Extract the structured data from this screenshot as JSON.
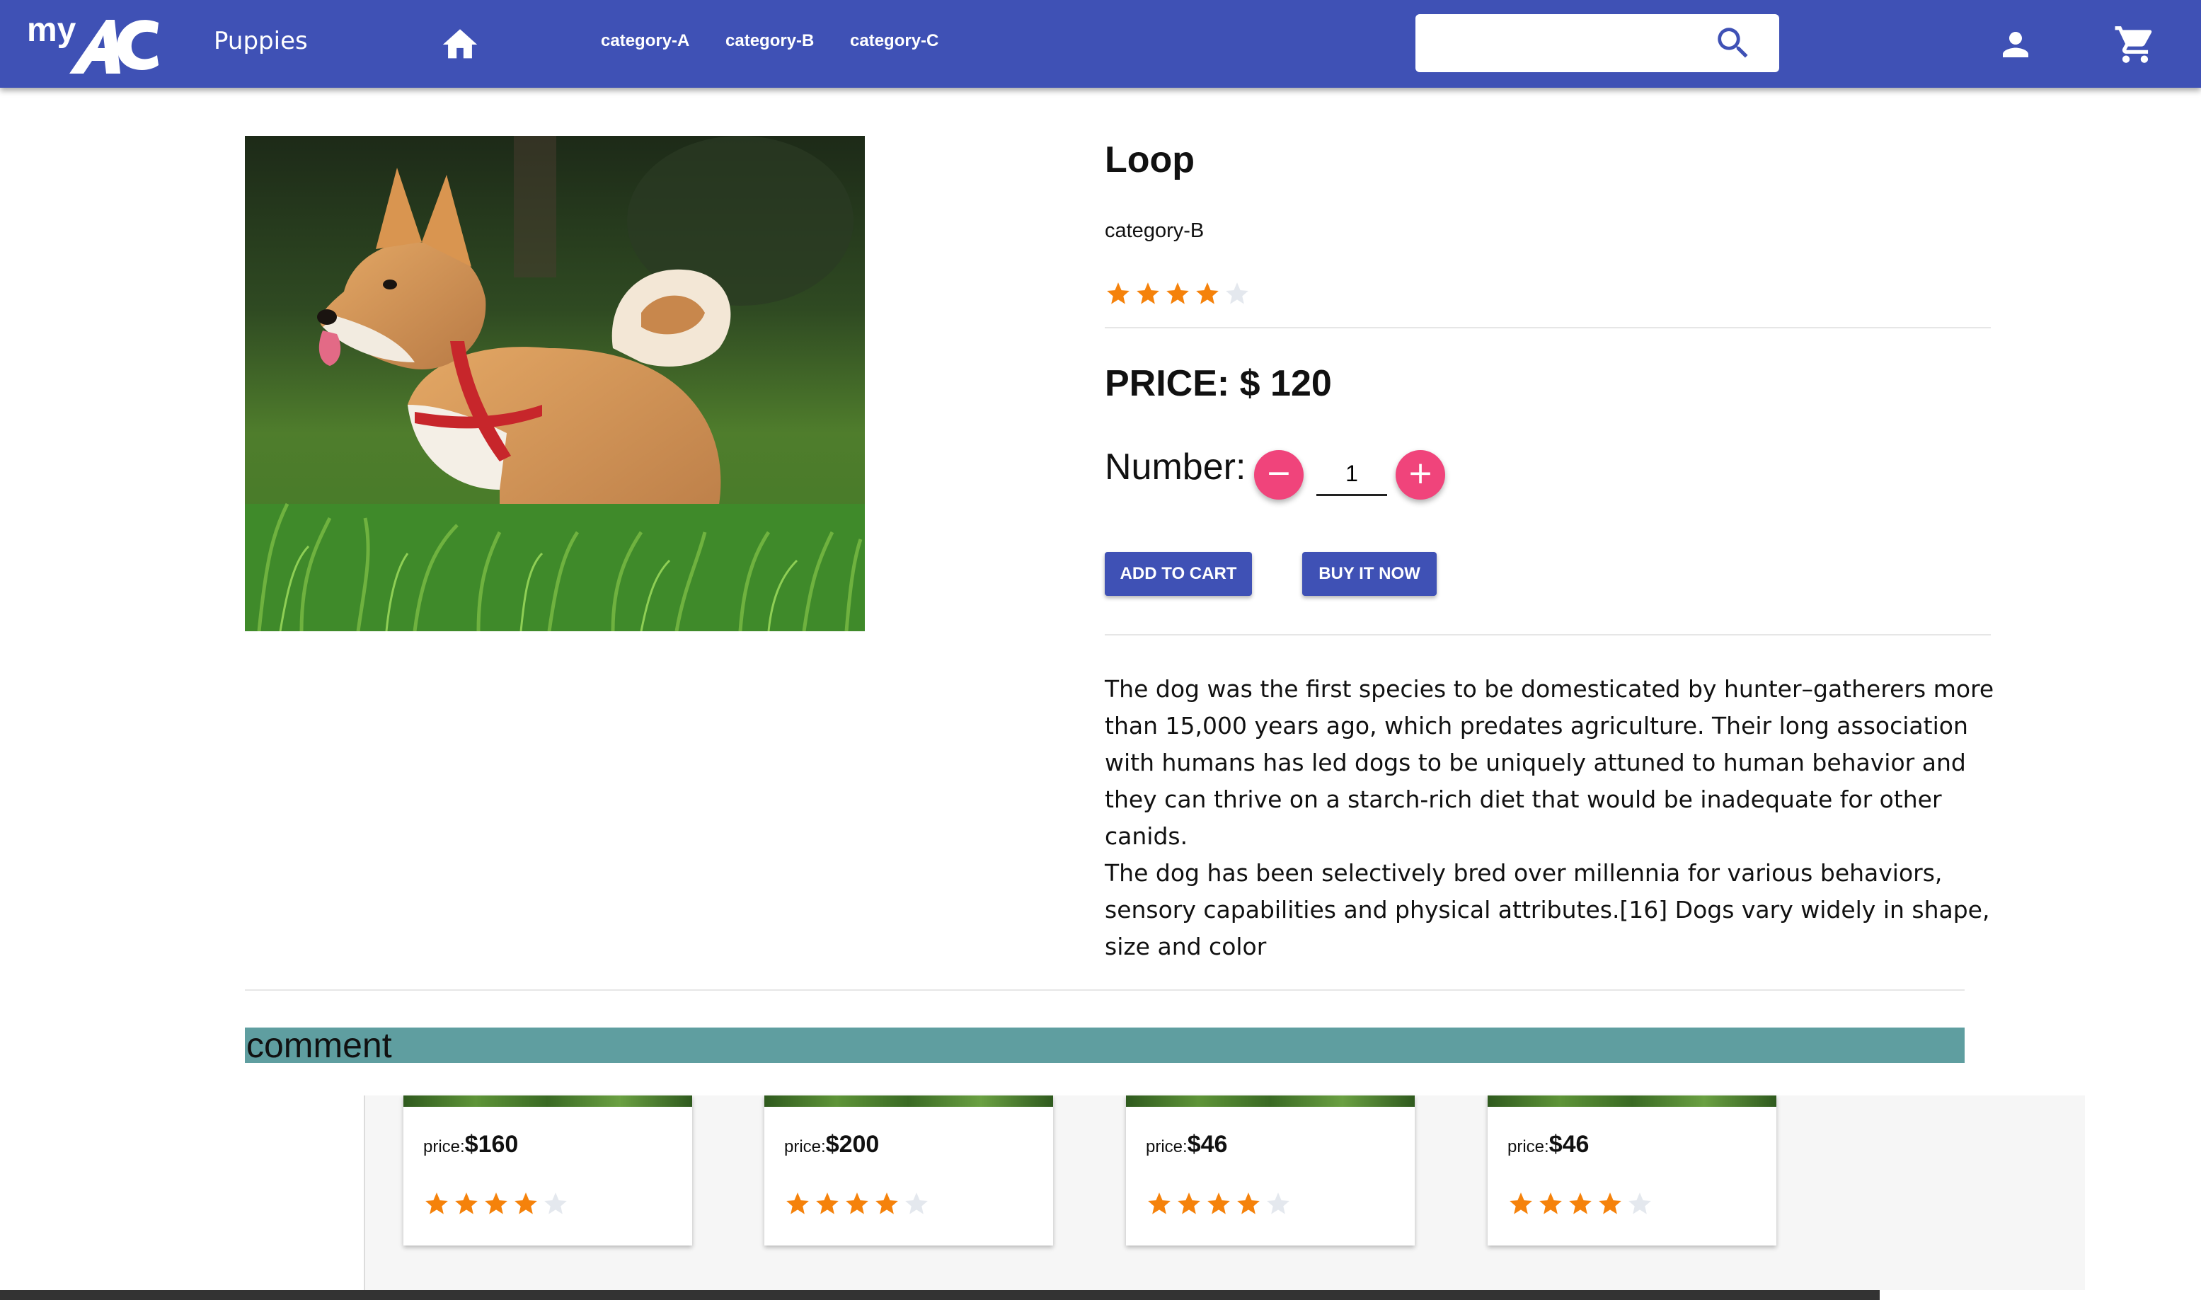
{
  "header": {
    "brand": "Puppies",
    "nav": [
      "category-A",
      "category-B",
      "category-C"
    ],
    "search_placeholder": "",
    "color": "#3f51b5"
  },
  "product": {
    "title": "Loop",
    "category": "category-B",
    "rating": 4,
    "rating_max": 5,
    "price": "PRICE: $ 120",
    "number_label": "Number:",
    "quantity": "1",
    "add_to_cart": "ADD TO CART",
    "buy_now": "BUY IT NOW",
    "description": [
      "The dog was the first species to be domesticated by hunter–gatherers more than 15,000 years ago, which predates agriculture. Their long association with humans has led dogs to be uniquely attuned to human behavior and they can thrive on a starch-rich diet that would be inadequate for other canids.",
      "The dog has been selectively bred over millennia for various behaviors, sensory capabilities and physical attributes.[16] Dogs vary widely in shape, size and color"
    ]
  },
  "comment": {
    "label": "comment",
    "color": "#5f9ea0"
  },
  "related": [
    {
      "price_prefix": "price:",
      "price": "$160",
      "rating": 4
    },
    {
      "price_prefix": "price:",
      "price": "$200",
      "rating": 4
    },
    {
      "price_prefix": "price:",
      "price": "$46",
      "rating": 4
    },
    {
      "price_prefix": "price:",
      "price": "$46",
      "rating": 4
    }
  ],
  "colors": {
    "star_filled": "#f5820b",
    "star_empty": "#e4e8ee",
    "accent_pink": "#f0447b"
  }
}
